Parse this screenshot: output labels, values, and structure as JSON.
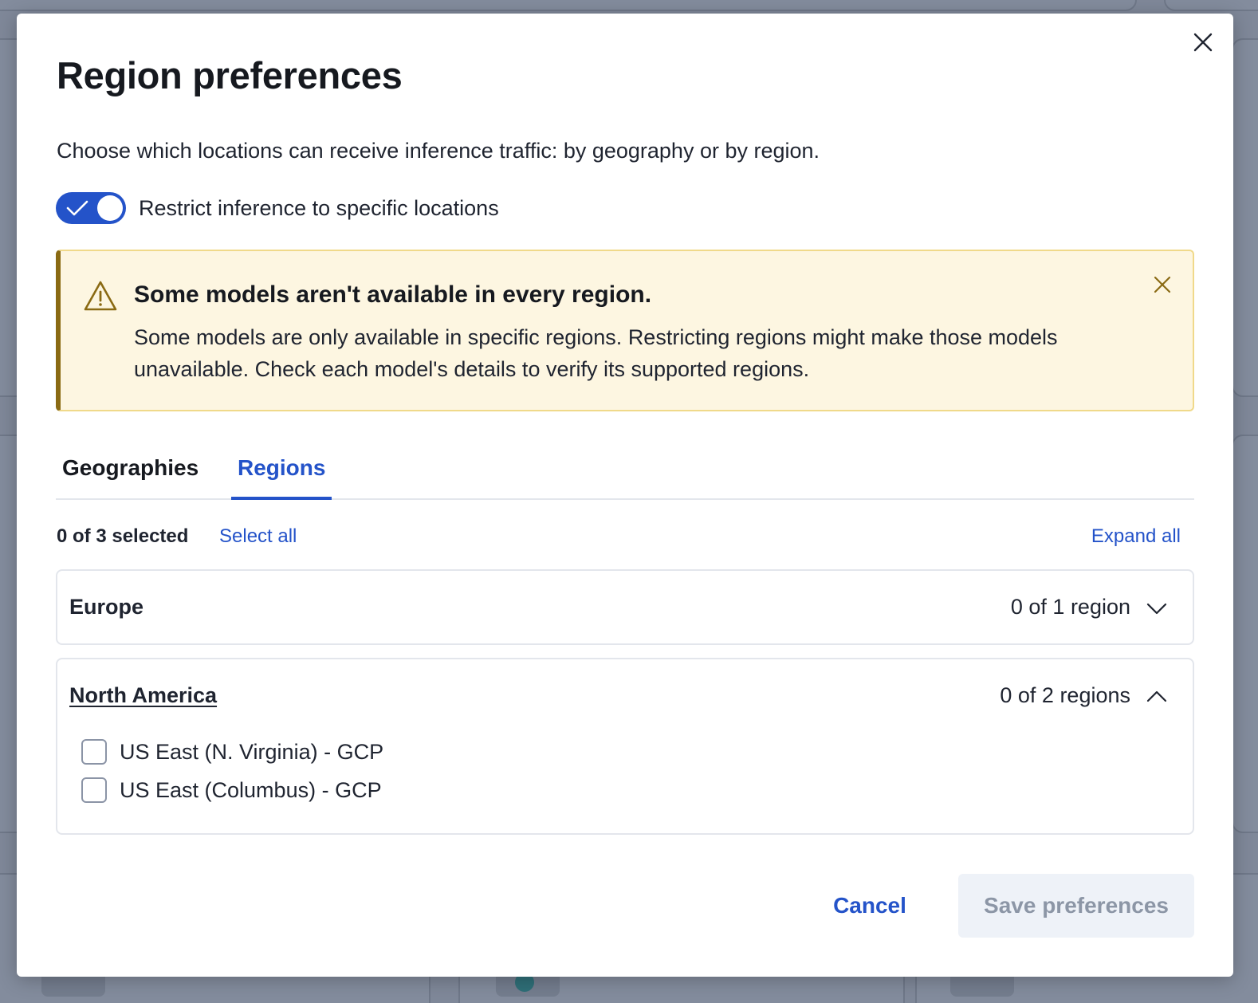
{
  "dialog": {
    "title": "Region preferences",
    "description": "Choose which locations can receive inference traffic: by geography or by region.",
    "close_icon": "close-icon"
  },
  "restrict_toggle": {
    "label": "Restrict inference to specific locations",
    "checked": true,
    "accent_color": "#2453c9"
  },
  "alert": {
    "icon": "warning-icon",
    "title": "Some models aren't available in every region.",
    "body": "Some models are only available in specific regions. Restricting regions might make those models unavailable. Check each model's details to verify its supported regions.",
    "background_color": "#fdf6e1"
  },
  "tabs": [
    {
      "label": "Geographies",
      "active": false
    },
    {
      "label": "Regions",
      "active": true
    }
  ],
  "selection": {
    "summary": "0 of 3 selected",
    "select_all_label": "Select all",
    "expand_all_label": "Expand all"
  },
  "groups": [
    {
      "name": "Europe",
      "count_label": "0 of 1 region",
      "expanded": false,
      "options": []
    },
    {
      "name": "North America",
      "count_label": "0 of 2 regions",
      "expanded": true,
      "options": [
        {
          "label": "US East (N. Virginia) - GCP",
          "checked": false
        },
        {
          "label": "US East (Columbus) - GCP",
          "checked": false
        }
      ]
    }
  ],
  "footer": {
    "cancel_label": "Cancel",
    "save_label": "Save preferences",
    "save_enabled": false
  }
}
